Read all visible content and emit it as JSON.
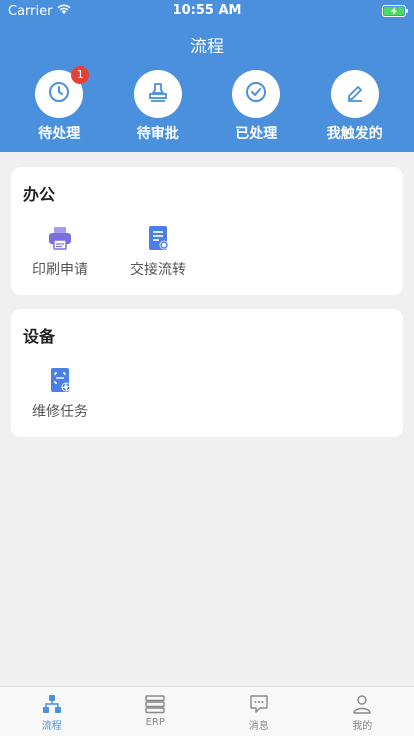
{
  "status_bar": {
    "carrier": "Carrier",
    "time": "10:55 AM"
  },
  "header": {
    "title": "流程"
  },
  "quick_actions": [
    {
      "label": "待处理",
      "icon": "clock-icon",
      "badge": "1"
    },
    {
      "label": "待审批",
      "icon": "stamp-icon"
    },
    {
      "label": "已处理",
      "icon": "check-circle-icon"
    },
    {
      "label": "我触发的",
      "icon": "pen-icon"
    }
  ],
  "sections": [
    {
      "title": "办公",
      "items": [
        {
          "label": "印刷申请",
          "icon": "printer-icon"
        },
        {
          "label": "交接流转",
          "icon": "document-transfer-icon"
        }
      ]
    },
    {
      "title": "设备",
      "items": [
        {
          "label": "维修任务",
          "icon": "maintenance-document-icon"
        }
      ]
    }
  ],
  "tabbar": [
    {
      "label": "流程",
      "icon": "workflow-icon",
      "active": true
    },
    {
      "label": "ERP",
      "icon": "server-icon"
    },
    {
      "label": "消息",
      "icon": "message-icon"
    },
    {
      "label": "我的",
      "icon": "user-icon"
    }
  ],
  "colors": {
    "primary": "#4a90dd",
    "badge": "#e54235",
    "printer": "#7b6fe0",
    "document": "#4a7fe8"
  }
}
